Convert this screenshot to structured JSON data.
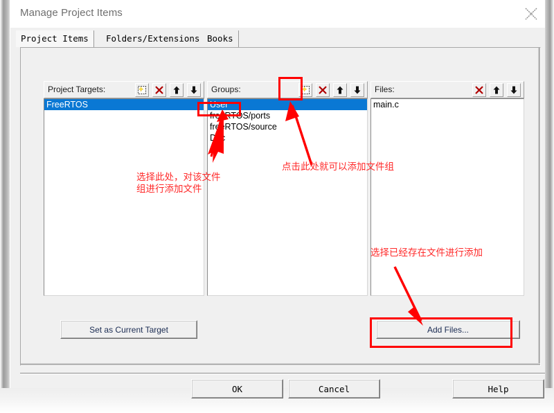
{
  "window": {
    "title": "Manage Project Items",
    "close_icon": "close-icon"
  },
  "tabs": [
    {
      "label": "Project Items",
      "active": true
    },
    {
      "label": "Folders/Extensions",
      "active": false
    },
    {
      "label": "Books",
      "active": false
    }
  ],
  "columns": {
    "project_targets": {
      "label": "Project Targets:",
      "tools": [
        "new-icon",
        "delete-icon",
        "move-up-icon",
        "move-down-icon"
      ],
      "items": [
        {
          "text": "FreeRTOS",
          "selected": true
        }
      ]
    },
    "groups": {
      "label": "Groups:",
      "tools": [
        "new-icon",
        "delete-icon",
        "move-up-icon",
        "move-down-icon"
      ],
      "items": [
        {
          "text": "User",
          "selected": true
        },
        {
          "text": "freeRTOS/ports",
          "selected": false
        },
        {
          "text": "freeRTOS/source",
          "selected": false
        },
        {
          "text": "Doc",
          "selected": false
        }
      ]
    },
    "files": {
      "label": "Files:",
      "tools": [
        "delete-icon",
        "move-up-icon",
        "move-down-icon"
      ],
      "items": [
        {
          "text": "main.c",
          "selected": false
        }
      ]
    }
  },
  "actions": {
    "set_as_current_target": "Set as Current Target",
    "add_files": "Add Files..."
  },
  "footer_buttons": {
    "ok": "OK",
    "cancel": "Cancel",
    "help": "Help"
  },
  "annotations": {
    "select_group_line1": "选择此处，对该文件",
    "select_group_line2": "组进行添加文件",
    "click_to_add_group": "点击此处就可以添加文件组",
    "select_existing_file": "选择已经存在文件进行添加"
  },
  "colors": {
    "annotation_red": "#ff2a2a",
    "highlight_red": "#ff0000",
    "selection_blue": "#0a78d4",
    "dialog_face": "#f0f0f0",
    "title_text": "#6f6f6f"
  }
}
